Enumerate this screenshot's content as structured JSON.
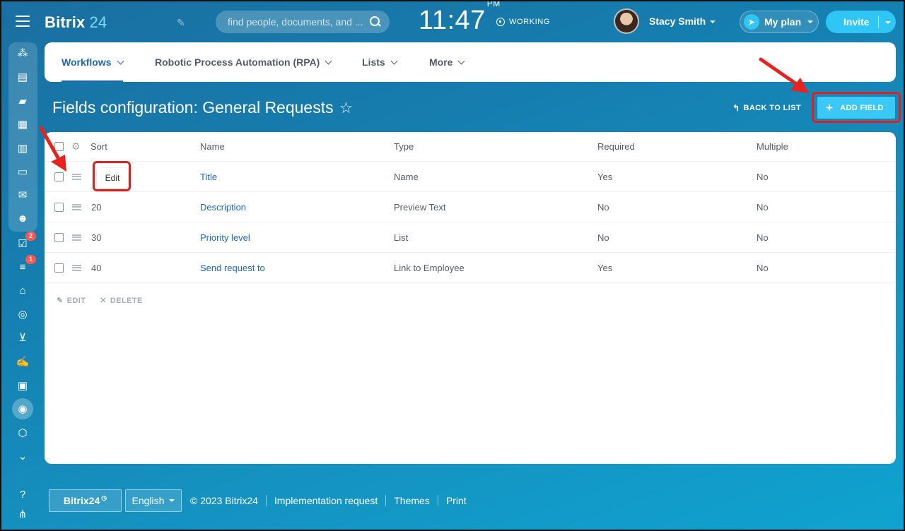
{
  "header": {
    "logo_name": "Bitrix",
    "logo_num": "24",
    "search_placeholder": "find people, documents, and ...",
    "clock": "11:47",
    "clock_ampm": "PM",
    "status": "WORKING",
    "user_name": "Stacy Smith",
    "plan_label": "My plan",
    "invite_label": "Invite"
  },
  "sidebar": {
    "badges": {
      "tasks": "2",
      "feed": "1"
    }
  },
  "nav": {
    "tabs": [
      {
        "label": "Workflows"
      },
      {
        "label": "Robotic Process Automation (RPA)"
      },
      {
        "label": "Lists"
      },
      {
        "label": "More"
      }
    ]
  },
  "page": {
    "title": "Fields configuration: General Requests",
    "back_label": "BACK TO LIST",
    "add_label": "ADD FIELD"
  },
  "table": {
    "columns": {
      "sort": "Sort",
      "name": "Name",
      "type": "Type",
      "required": "Required",
      "multiple": "Multiple"
    },
    "rows": [
      {
        "sort": "",
        "name": "Title",
        "type": "Name",
        "required": "Yes",
        "multiple": "No"
      },
      {
        "sort": "20",
        "name": "Description",
        "type": "Preview Text",
        "required": "No",
        "multiple": "No"
      },
      {
        "sort": "30",
        "name": "Priority level",
        "type": "List",
        "required": "No",
        "multiple": "No"
      },
      {
        "sort": "40",
        "name": "Send request to",
        "type": "Link to Employee",
        "required": "Yes",
        "multiple": "No"
      }
    ],
    "edit_popup": "Edit",
    "actions": {
      "edit": "EDIT",
      "delete": "DELETE"
    }
  },
  "footer": {
    "brand": "Bitrix24",
    "language": "English",
    "copyright": "© 2023 Bitrix24",
    "links": [
      "Implementation request",
      "Themes",
      "Print"
    ]
  },
  "colors": {
    "accent": "#2fc6f6",
    "link": "#2067b0",
    "highlight": "#e02020"
  }
}
